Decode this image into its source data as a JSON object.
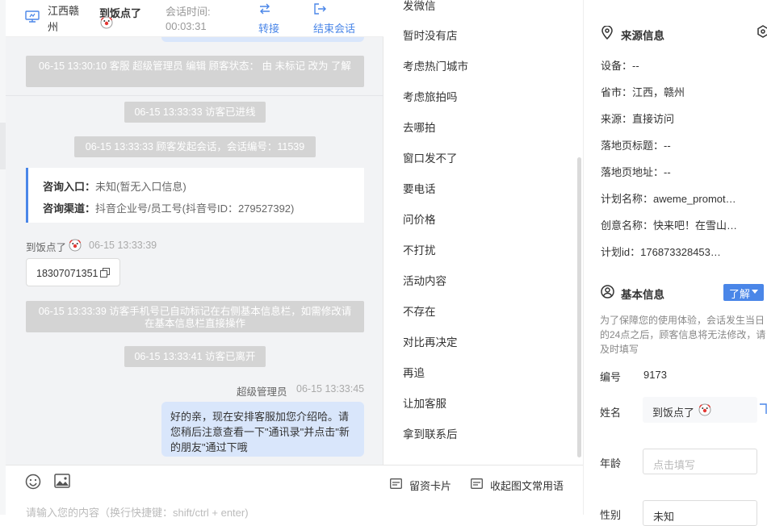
{
  "header": {
    "location": "江西赣州",
    "visitor_name": "到饭点了",
    "session_time_label": "会话时间:",
    "session_time": "00:03:31",
    "transfer_label": "转接",
    "end_label": "结束会话"
  },
  "messages": {
    "sys_status": "06-15 13:30:10 客服 超级管理员 编辑 顾客状态： 由 未标记 改为 了解",
    "sys_entered": "06-15 13:33:33 访客已进线",
    "sys_session": "06-15 13:33:33 顾客发起会话，会话编号：11539",
    "info_entry_label": "咨询入口：",
    "info_entry_value": "未知(暂无入口信息)",
    "info_channel_label": "咨询渠道：",
    "info_channel_value": "抖音企业号/员工号(抖音号ID：279527392)",
    "visitor_name": "到饭点了",
    "visitor_time": "06-15 13:33:39",
    "visitor_phone": "18307071351",
    "sys_phone": "06-15 13:33:39 访客手机号已自动标记在右侧基本信息栏，如需修改请在基本信息栏直接操作",
    "sys_left": "06-15 13:33:41 访客已离开",
    "agent_name": "超级管理员",
    "agent_time": "06-15 13:33:45",
    "agent_text": "好的亲，现在安排客服加您介绍哈。请您稍后注意查看一下\"通讯录\"并点击\"新的朋友\"通过下哦"
  },
  "quick_replies": [
    "发微信",
    "暂时没有店",
    "考虑热门城市",
    "考虑旅拍吗",
    "去哪拍",
    "窗口发不了",
    "要电话",
    "问价格",
    "不打扰",
    "活动内容",
    "不存在",
    "对比再决定",
    "再追",
    "让加客服",
    "拿到联系后"
  ],
  "input": {
    "placeholder": "请输入您的内容（换行快捷键：shift/ctrl + enter)",
    "card_label": "留资卡片",
    "collapse_label": "收起图文常用语"
  },
  "source": {
    "title": "来源信息",
    "device_label": "设备：",
    "device_value": "--",
    "province_label": "省市：",
    "province_value": "江西，赣州",
    "source_label": "来源：",
    "source_value": "直接访问",
    "landing_title_label": "落地页标题：",
    "landing_title_value": "--",
    "landing_url_label": "落地页地址：",
    "landing_url_value": "--",
    "plan_name_label": "计划名称：",
    "plan_name_value": "aweme_promot…",
    "creative_label": "创意名称：",
    "creative_value": "快来吧！在雪山…",
    "plan_id_label": "计划id：",
    "plan_id_value": "176873328453…"
  },
  "basic": {
    "title": "基本信息",
    "status_button": "了解",
    "note": "为了保障您的使用体验，会话发生当日的24点之后，顾客信息将无法修改，请及时填写",
    "number_label": "编号",
    "number_value": "9173",
    "name_label": "姓名",
    "name_value": "到饭点了",
    "age_label": "年龄",
    "age_placeholder": "点击填写",
    "gender_label": "性别",
    "gender_value": "未知"
  },
  "colors": {
    "accent": "#4a86e8",
    "agent_bubble": "#d9e6fb",
    "system_message": "#d4d4d4",
    "chat_background": "#f2f3f5"
  }
}
